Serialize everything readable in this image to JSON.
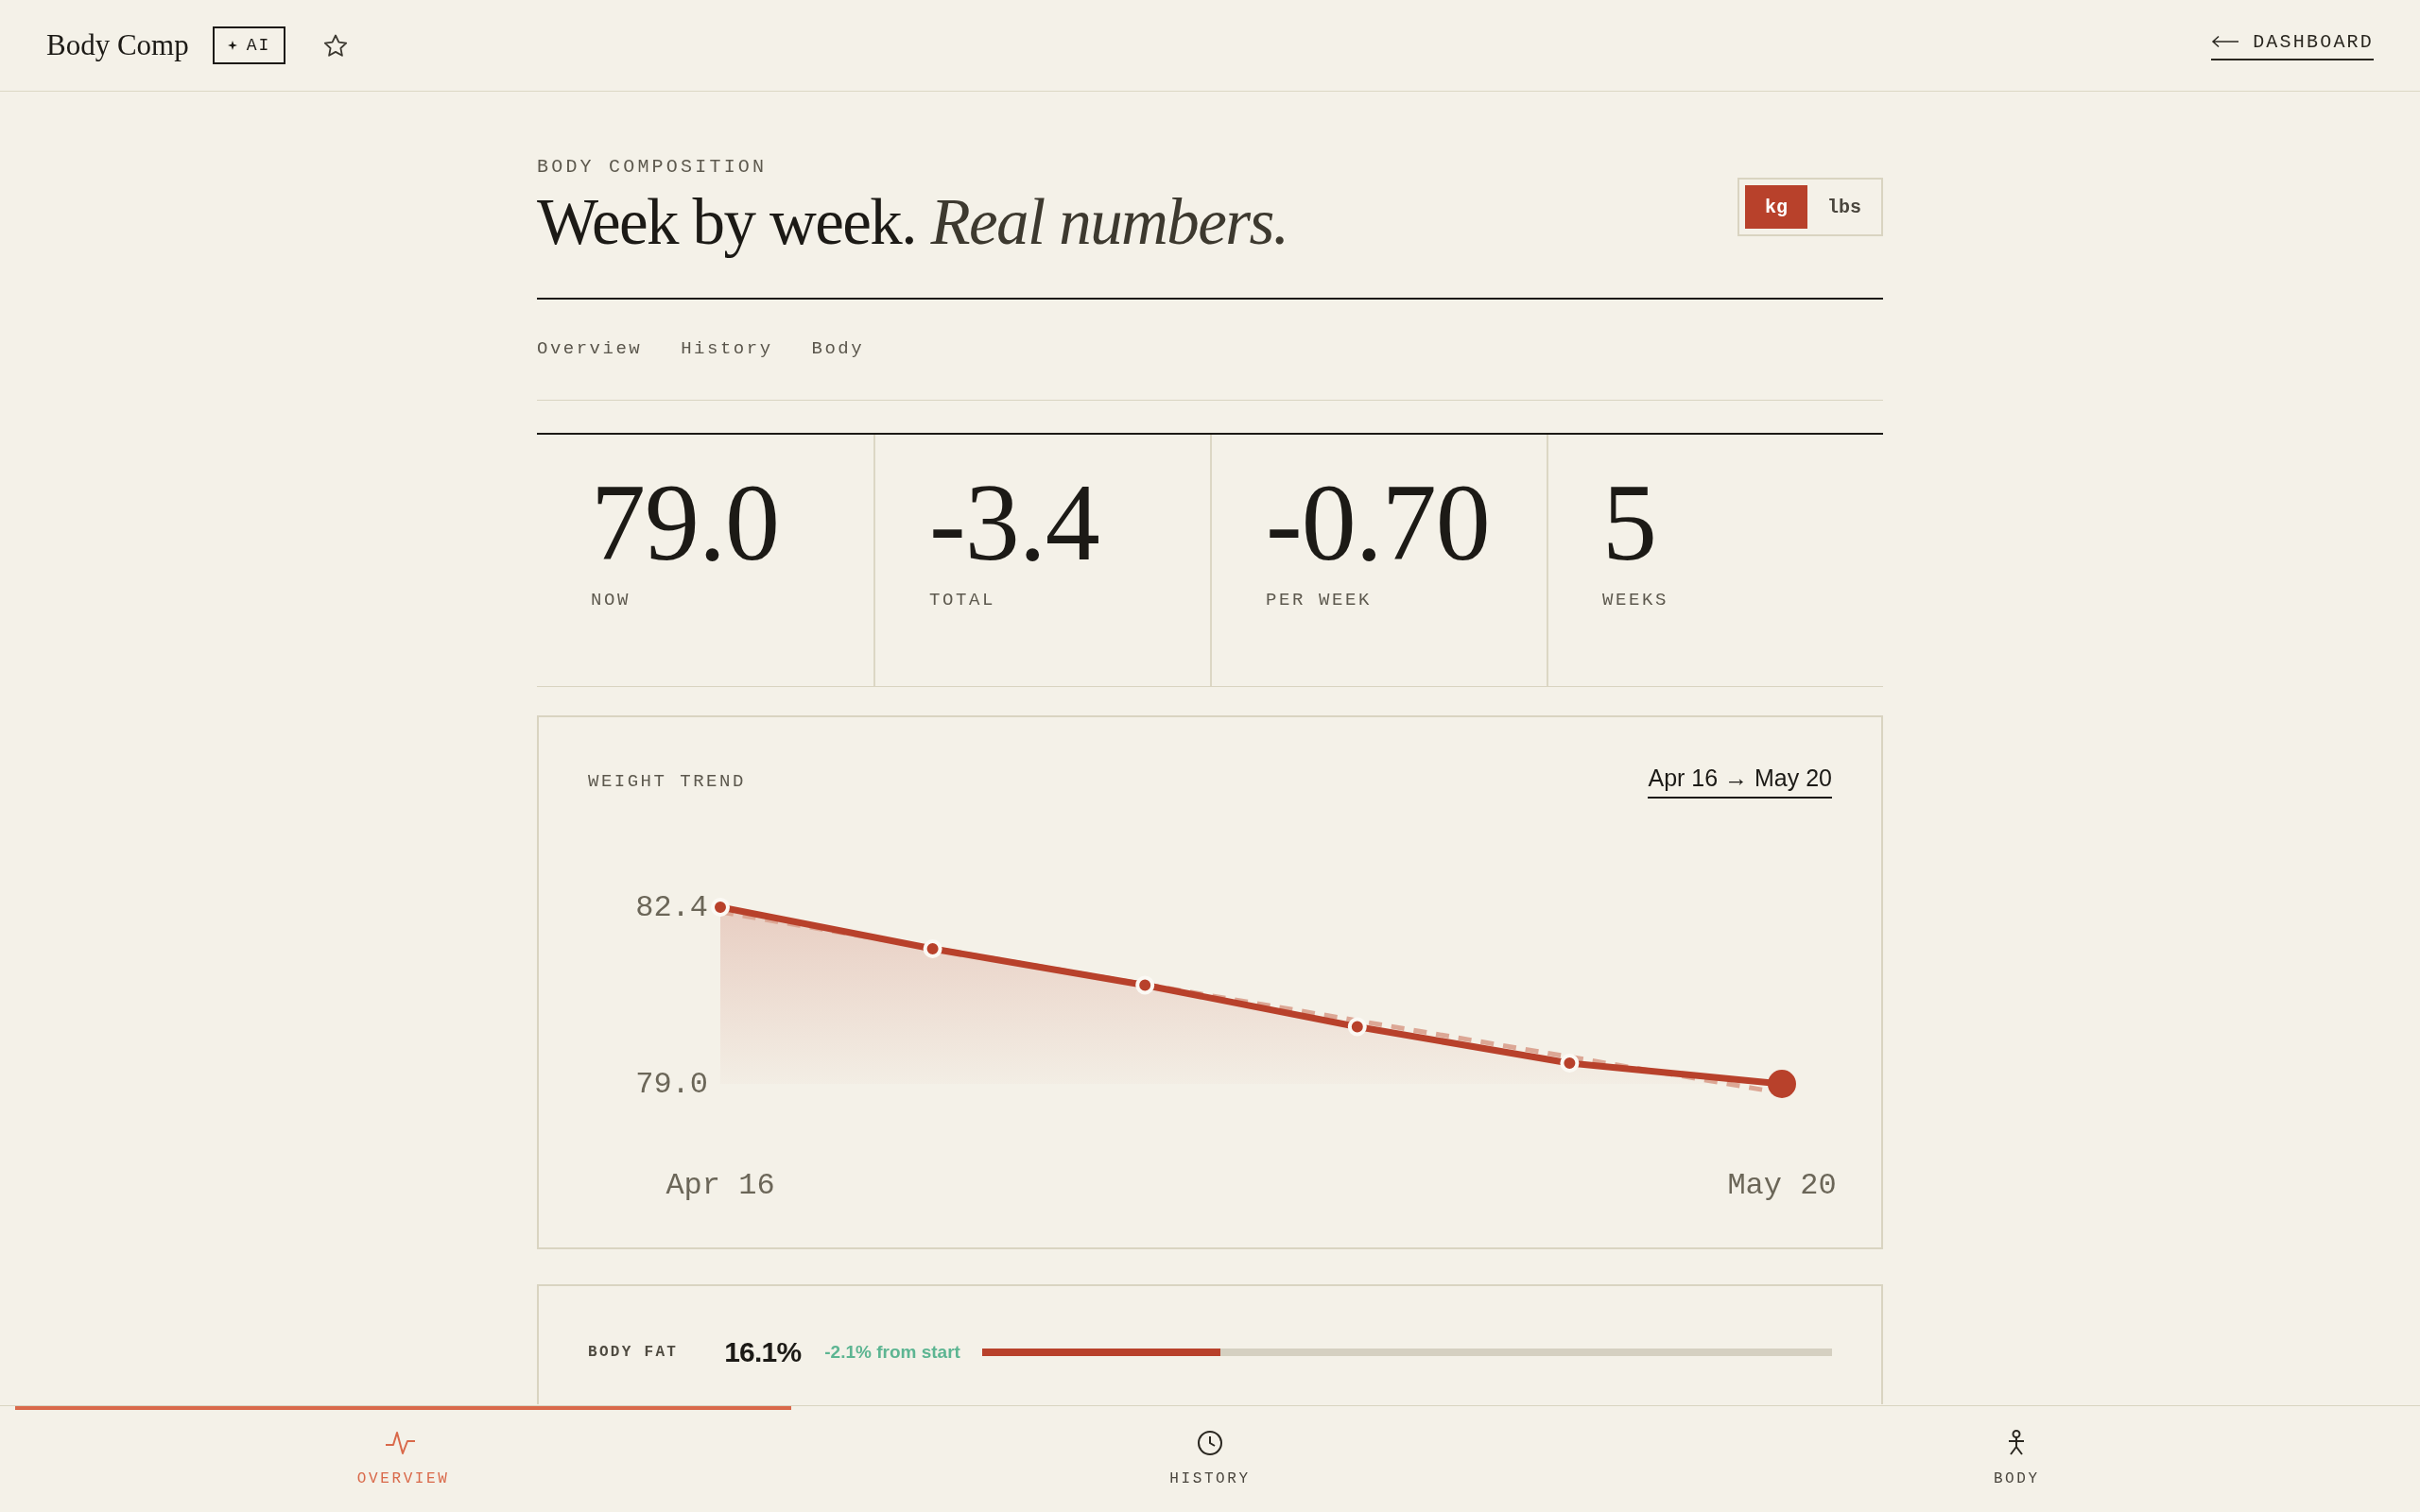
{
  "app_bar": {
    "title": "Body Comp",
    "badge": "AI",
    "back_link": "DASHBOARD"
  },
  "header": {
    "eyebrow": "BODY COMPOSITION",
    "title": "Week by week. *Real numbers.*",
    "units": [
      {
        "label": "kg",
        "selected": true
      },
      {
        "label": "lbs",
        "selected": false
      }
    ]
  },
  "tabs": [
    {
      "label": "Overview"
    },
    {
      "label": "History"
    },
    {
      "label": "Body"
    }
  ],
  "stats": [
    {
      "value": "79.0",
      "label": "NOW"
    },
    {
      "value": "-3.4",
      "label": "TOTAL"
    },
    {
      "value": "-0.70",
      "label": "PER WEEK"
    },
    {
      "value": "5",
      "label": "WEEKS"
    }
  ],
  "weight_trend": {
    "range": "Apr 16 → May 20",
    "chart_data": {
      "type": "area",
      "title": "WEIGHT TREND",
      "categories": [
        "Apr 16",
        null,
        null,
        null,
        null,
        "May 20"
      ],
      "values": [
        82.4,
        81.6,
        80.9,
        80.1,
        79.4,
        79.0
      ],
      "ylim": [
        79,
        82.4
      ],
      "yticks": [
        {
          "value": 82.4,
          "label": "82.4"
        },
        {
          "value": 79,
          "label": "79.0"
        }
      ]
    }
  },
  "body_fat": {
    "label": "BODY FAT",
    "value": "16.1%",
    "change": "-2.1% from start",
    "level": 0.28
  },
  "bottom_nav": [
    {
      "label": "OVERVIEW",
      "selected": true
    },
    {
      "label": "HISTORY",
      "selected": false
    },
    {
      "label": "BODY",
      "selected": false
    }
  ]
}
